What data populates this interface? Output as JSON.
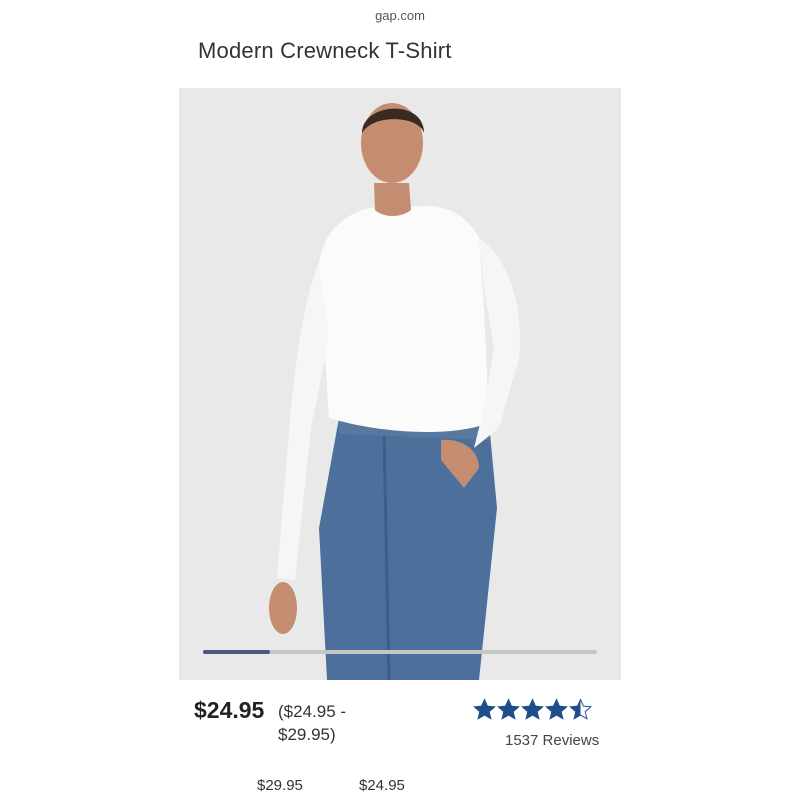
{
  "browser": {
    "url": "gap.com"
  },
  "product": {
    "title": "Modern Crewneck T-Shirt",
    "price": "$24.95",
    "price_range_line1": "($24.95 -",
    "price_range_line2": "$29.95)"
  },
  "hero": {
    "image_alt": "Model wearing white long-sleeve crewneck shirt and blue jeans",
    "carousel_position": 0.17
  },
  "rating": {
    "stars": 4.5,
    "max": 5,
    "reviews_label": "1537 Reviews"
  },
  "swatches": [
    {
      "price": "$29.95"
    },
    {
      "price": "$24.95"
    }
  ],
  "colors": {
    "star": "#1f4e8c",
    "carousel_active": "#4a5a7c"
  }
}
